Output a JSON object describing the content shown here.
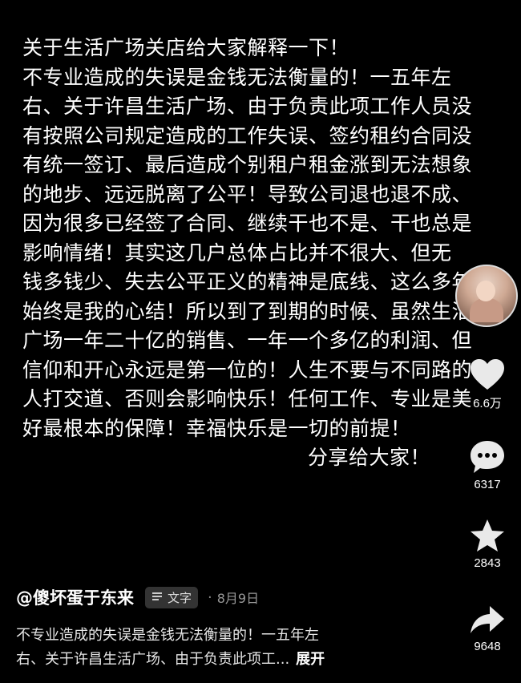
{
  "post_text": [
    "关于生活广场关店给大家解释一下！",
    "不专业造成的失误是金钱无法衡量的！一五年左",
    "右、关于许昌生活广场、由于负责此项工作人员没",
    "有按照公司规定造成的工作失误、签约租约合同没",
    "有统一签订、最后造成个别租户租金涨到无法想象",
    "的地步、远远脱离了公平！导致公司退也退不成、",
    "因为很多已经签了合同、继续干也不是、干也总是",
    "影响情绪！其实这几户总体占比并不很大、但无",
    "钱多钱少、失去公平正义的精神是底线、这么多年",
    "始终是我的心结！所以到了到期的时候、虽然生活",
    "广场一年二十亿的销售、一年一个多亿的利润、但",
    "信仰和开心永远是第一位的！人生不要与不同路的",
    "人打交道、否则会影响快乐！任何工作、专业是美",
    "好最根本的保障！幸福快乐是一切的前提！",
    "分享给大家！"
  ],
  "actions": {
    "like_count": "6.6万",
    "comment_count": "6317",
    "favorite_count": "2843",
    "share_count": "9648"
  },
  "author": {
    "handle": "@傻坏蛋于东来",
    "tag_label": "文字",
    "separator": "·",
    "date": "8月9日"
  },
  "description": {
    "line1": "不专业造成的失误是金钱无法衡量的！一五年左",
    "line2": "右、关于许昌生活广场、由于负责此项工...",
    "expand_label": "展开"
  },
  "colors": {
    "background": "#000000",
    "text": "#ffffff",
    "muted": "#999999",
    "tag_bg": "#333333"
  }
}
